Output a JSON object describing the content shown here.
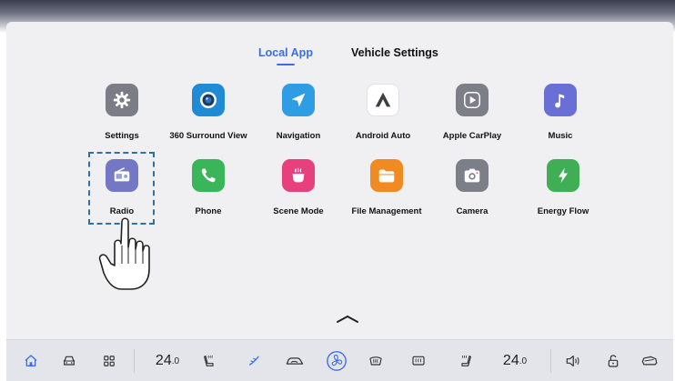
{
  "tabs": {
    "local_app": "Local App",
    "vehicle_settings": "Vehicle Settings",
    "active": "local_app"
  },
  "apps": {
    "settings": "Settings",
    "surround_view": "360 Surround View",
    "navigation": "Navigation",
    "android_auto": "Android Auto",
    "apple_carplay": "Apple CarPlay",
    "music": "Music",
    "radio": "Radio",
    "phone": "Phone",
    "scene_mode": "Scene Mode",
    "file_management": "File Management",
    "camera": "Camera",
    "energy_flow": "Energy Flow"
  },
  "dock": {
    "temp_left_whole": "24",
    "temp_left_decimal": ".0",
    "temp_right_whole": "24",
    "temp_right_decimal": ".0"
  },
  "colors": {
    "accent": "#3b6ee6",
    "settings": "#7b7c86",
    "surround_view": "#1f8ad6",
    "navigation": "#2f9de3",
    "android_auto": "#ffffff",
    "apple_carplay": "#7d7f88",
    "music": "#6a6fd6",
    "radio": "#7478c4",
    "phone": "#3bb55a",
    "scene_mode": "#e8407d",
    "file_management": "#f28a22",
    "camera": "#7d7f88",
    "energy_flow": "#3fae55"
  },
  "icons": {
    "settings": "gear-icon",
    "surround_view": "camera-lens-icon",
    "navigation": "navigation-arrow-icon",
    "android_auto": "android-auto-icon",
    "apple_carplay": "carplay-play-icon",
    "music": "music-note-icon",
    "radio": "radio-icon",
    "phone": "phone-icon",
    "scene_mode": "cup-icon",
    "file_management": "folder-icon",
    "camera": "camera-icon",
    "energy_flow": "lightning-icon"
  }
}
